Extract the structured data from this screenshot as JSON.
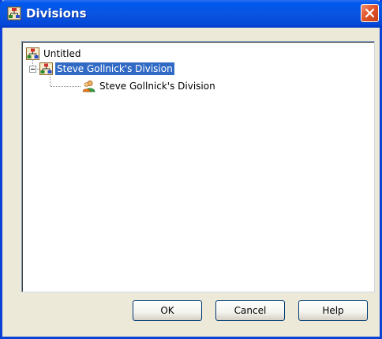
{
  "window": {
    "title": "Divisions",
    "close_icon": "close-icon",
    "title_icon": "divisions-icon",
    "colors": {
      "titlebar": "#0a55e0",
      "close": "#e35a30",
      "selection": "#316ac5",
      "face": "#ece9d8"
    }
  },
  "tree": {
    "root": {
      "label": "Untitled",
      "icon": "org-chart-icon"
    },
    "division": {
      "label": "Steve Gollnick's Division",
      "icon": "org-chart-icon",
      "expanded": true,
      "selected": true
    },
    "child": {
      "label": "Steve Gollnick's Division",
      "icon": "user-icon"
    }
  },
  "buttons": {
    "ok": "OK",
    "cancel": "Cancel",
    "help": "Help"
  }
}
